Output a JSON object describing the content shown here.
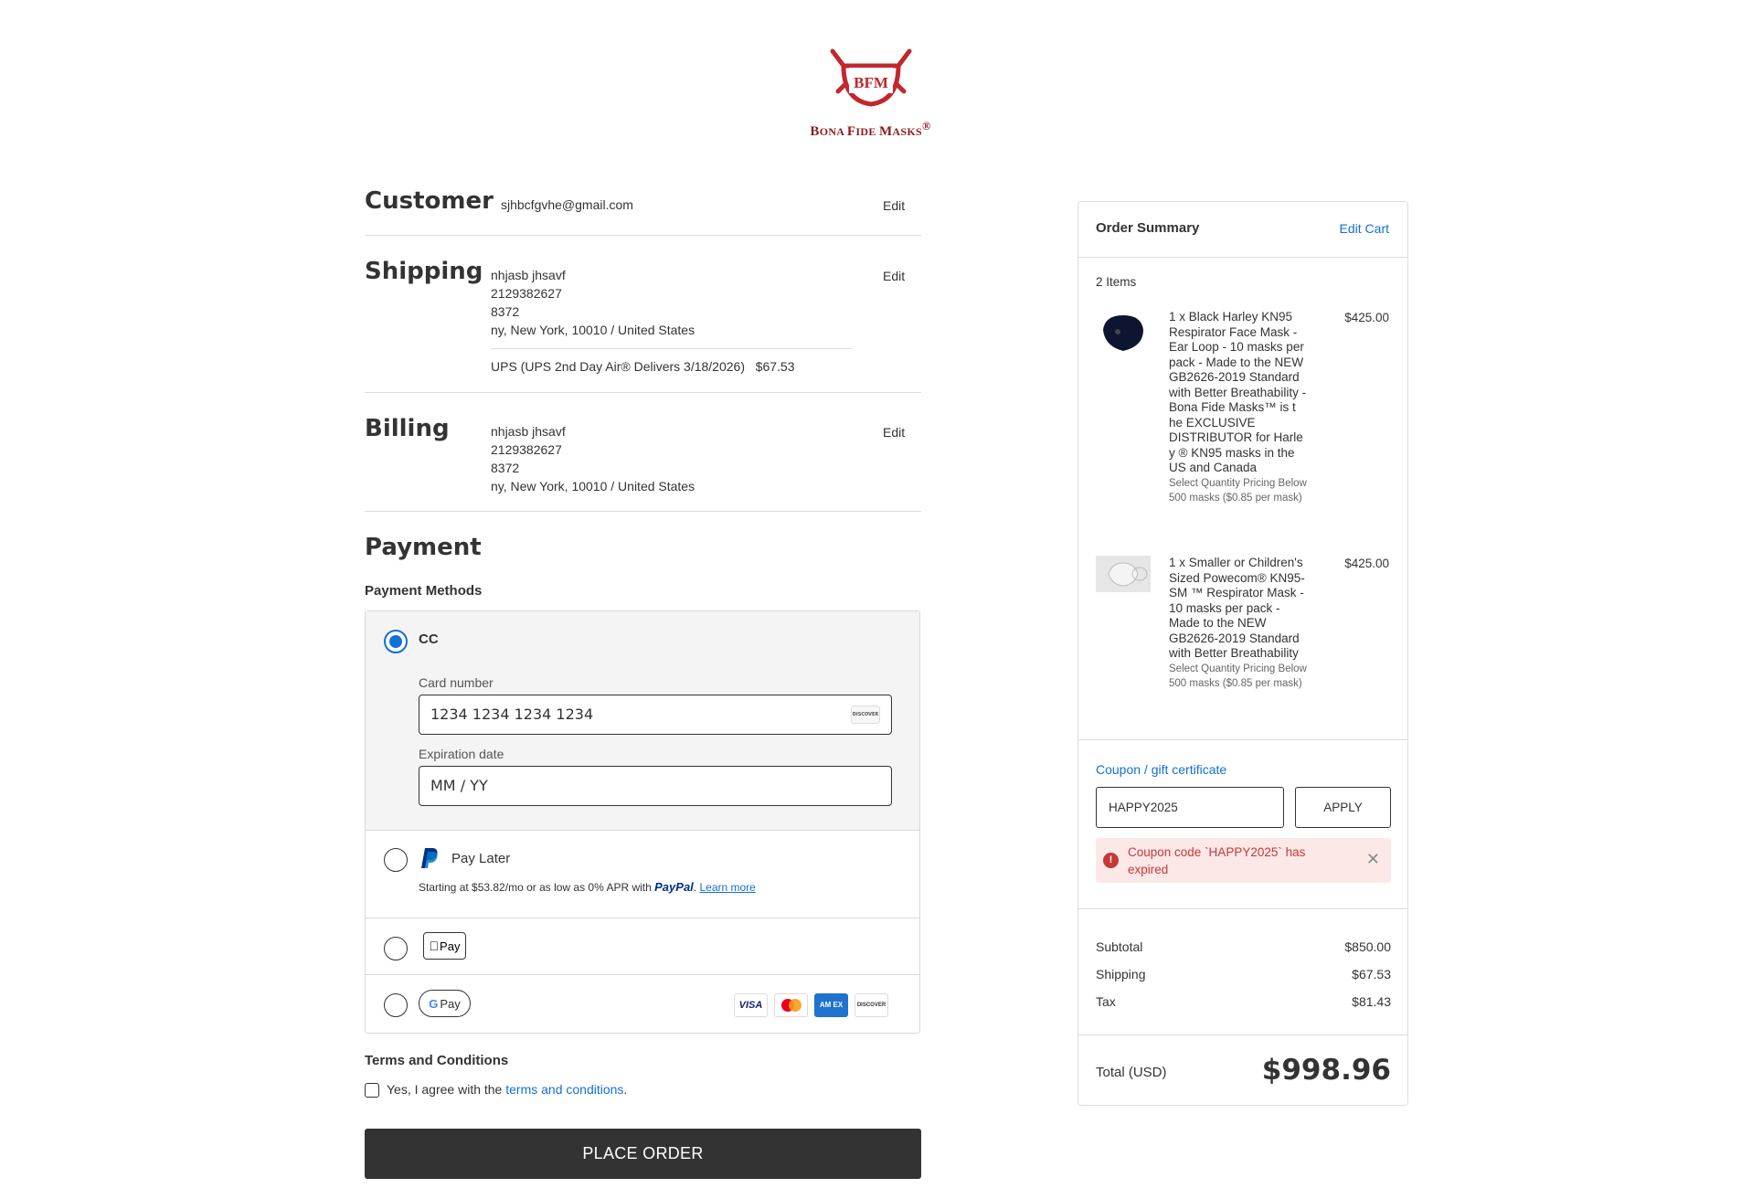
{
  "brand": {
    "logo_initials": "BFM",
    "logo_text_b": "B",
    "logo_text_ona": "ONA ",
    "logo_text_f": "F",
    "logo_text_ide": "IDE ",
    "logo_text_m": "M",
    "logo_text_asks": "ASKS",
    "logo_reg": "®"
  },
  "customer": {
    "heading": "Customer",
    "email": "sjhbcfgvhe@gmail.com",
    "edit_label": "Edit"
  },
  "shipping": {
    "heading": "Shipping",
    "edit_label": "Edit",
    "name": "nhjasb jhsavf",
    "phone": "2129382627",
    "line1": "8372",
    "city_line": "ny, New York, 10010 / United States",
    "method": "UPS (UPS 2nd Day Air® Delivers 3/18/2026)",
    "method_price": "$67.53"
  },
  "billing": {
    "heading": "Billing",
    "edit_label": "Edit",
    "name": "nhjasb jhsavf",
    "phone": "2129382627",
    "line1": "8372",
    "city_line": "ny, New York, 10010 / United States"
  },
  "payment": {
    "heading": "Payment",
    "methods_label": "Payment Methods",
    "cc_label": "CC",
    "card_number_label": "Card number",
    "card_number_placeholder": "1234 1234 1234 1234",
    "card_brand_badge": "DISCOVER",
    "exp_label": "Expiration date",
    "exp_placeholder": "MM / YY",
    "paylater_label": "Pay Later",
    "paylater_text": "Starting at $53.82/mo or as low as 0% APR with",
    "paypal_logo": "PayPal",
    "learn_more": "Learn more",
    "applepay_label": "Pay",
    "gpay_g": "G",
    "gpay_label": "Pay",
    "card_logos": [
      "VISA",
      "",
      "AM EX",
      "DISCOVER"
    ]
  },
  "terms": {
    "heading": "Terms and Conditions",
    "agree_prefix": "Yes, I agree with the ",
    "agree_link": "terms and conditions",
    "agree_suffix": "."
  },
  "place_order_label": "PLACE ORDER",
  "order_summary": {
    "title": "Order Summary",
    "edit_cart": "Edit Cart",
    "items_count": "2 Items",
    "items": [
      {
        "name": "1 x Black Harley KN95 Respirator Face Mask - Ear Loop - 10 masks per pack - Made to the NEW GB2626-2019 Standard with Better Breathability - Bona Fide Masks™ is t he EXCLUSIVE DISTRIBUTOR for Harle y ® KN95 masks in the US and Canada",
        "option": "Select Quantity Pricing Below 500 masks ($0.85 per mask)",
        "price": "$425.00"
      },
      {
        "name": "1 x Smaller or Children's Sized Powecom® KN95-SM ™ Respirator Mask - 10 masks per pack - Made to the NEW GB2626-2019 Standard with Better Breathability",
        "option": "Select Quantity Pricing Below 500 masks ($0.85 per mask)",
        "price": "$425.00"
      }
    ],
    "coupon_label": "Coupon / gift certificate",
    "coupon_value": "HAPPY2025",
    "apply_label": "APPLY",
    "error_text": "Coupon code `HAPPY2025` has expired",
    "subtotal_label": "Subtotal",
    "subtotal_value": "$850.00",
    "shipping_label": "Shipping",
    "shipping_value": "$67.53",
    "tax_label": "Tax",
    "tax_value": "$81.43",
    "total_label": "Total (USD)",
    "total_value": "$998.96"
  },
  "colors": {
    "accent_blue": "#1270d4",
    "error_red": "#c43838",
    "error_bg": "#fde8e8",
    "brand_red": "#c0282d",
    "button_dark": "#333333"
  }
}
